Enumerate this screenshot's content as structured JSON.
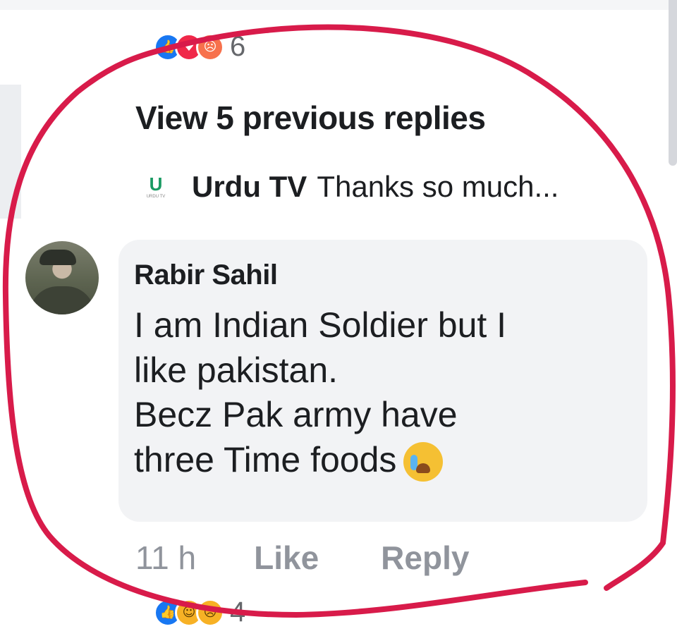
{
  "reactions_top": {
    "icons": [
      "like-icon",
      "love-icon",
      "angry-icon"
    ],
    "count": "6"
  },
  "thread": {
    "view_previous": "View 5 previous replies",
    "preview": {
      "logo_letter": "U",
      "logo_caption": "URDU TV",
      "name": "Urdu TV",
      "text": "Thanks so much..."
    }
  },
  "comment": {
    "author": "Rabir Sahil",
    "lines": [
      "I am Indian Soldier but I",
      "like pakistan.",
      "Becz Pak army have",
      "three Time foods"
    ],
    "emoji": "crying-laughing-icon",
    "time": "11 h",
    "like_label": "Like",
    "reply_label": "Reply"
  },
  "reactions_bottom": {
    "icons": [
      "like-icon",
      "haha-icon",
      "sad-icon"
    ],
    "count": "4"
  },
  "colors": {
    "annotation_red": "#d81b4a",
    "like_blue": "#1877f2",
    "bubble_bg": "#f2f3f5",
    "meta_gray": "#90949c"
  }
}
